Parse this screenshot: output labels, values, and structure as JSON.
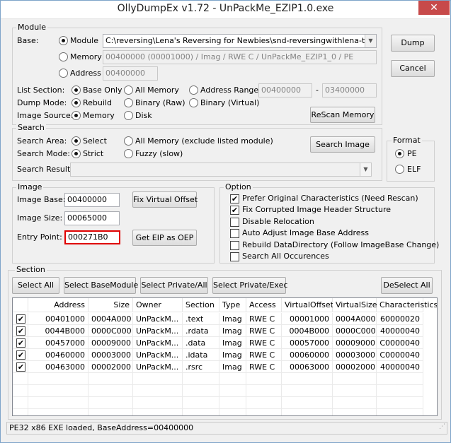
{
  "window": {
    "title": "OllyDumpEx v1.72 - UnPackMe_EZIP1.0.exe",
    "close_glyph": "✕"
  },
  "module": {
    "group_label": "Module",
    "base_label": "Base:",
    "opt_module": "Module",
    "module_path": "C:\\reversing\\Lena's Reversing for Newbies\\snd-reversingwithlena-tutorials\\sn",
    "opt_memory": "Memory",
    "memory_value": "00400000 (00001000) / Imag / RWE C / UnPackMe_EZIP1_0 / PE",
    "opt_address": "Address",
    "address_value": "00400000",
    "list_section_label": "List Section:",
    "ls_base_only": "Base Only",
    "ls_all_memory": "All Memory",
    "ls_address_range": "Address Range",
    "range_from": "00400000",
    "range_dash": "-",
    "range_to": "03400000",
    "dump_mode_label": "Dump Mode:",
    "dm_rebuild": "Rebuild",
    "dm_binary_raw": "Binary (Raw)",
    "dm_binary_virtual": "Binary (Virtual)",
    "image_source_label": "Image Source:",
    "is_memory": "Memory",
    "is_disk": "Disk",
    "rescan_button": "ReScan Memory"
  },
  "search": {
    "group_label": "Search",
    "area_label": "Search Area:",
    "area_select": "Select",
    "area_all_memory": "All Memory (exclude listed module)",
    "mode_label": "Search Mode:",
    "mode_strict": "Strict",
    "mode_fuzzy": "Fuzzy (slow)",
    "result_label": "Search Result:",
    "search_image_button": "Search Image"
  },
  "buttons": {
    "dump": "Dump",
    "cancel": "Cancel"
  },
  "format": {
    "group_label": "Format",
    "pe": "PE",
    "elf": "ELF"
  },
  "image": {
    "group_label": "Image",
    "base_label": "Image Base:",
    "base_value": "00400000",
    "size_label": "Image Size:",
    "size_value": "00065000",
    "entry_label": "Entry Point:",
    "entry_value": "000271B0",
    "fix_offset_button": "Fix Virtual Offset",
    "get_eip_button": "Get EIP as OEP"
  },
  "option": {
    "group_label": "Option",
    "items": [
      {
        "label": "Prefer Original Characteristics (Need Rescan)",
        "checked": "✔"
      },
      {
        "label": "Fix Corrupted Image Header Structure",
        "checked": "✔"
      },
      {
        "label": "Disable Relocation",
        "checked": ""
      },
      {
        "label": "Auto Adjust Image Base Address",
        "checked": ""
      },
      {
        "label": "Rebuild DataDirectory (Follow ImageBase Change)",
        "checked": ""
      },
      {
        "label": "Search All Occurences",
        "checked": ""
      }
    ]
  },
  "section": {
    "group_label": "Section",
    "select_all": "Select All",
    "select_basemodule": "Select BaseModule",
    "select_private_all": "Select Private/All",
    "select_private_exec": "Select Private/Exec",
    "deselect_all": "DeSelect All",
    "columns": [
      "Address",
      "Size",
      "Owner",
      "Section",
      "Type",
      "Access",
      "VirtualOffset",
      "VirtualSize",
      "Characteristics"
    ],
    "rows": [
      {
        "check": "✔",
        "address": "00401000",
        "size": "0004A000",
        "owner": "UnPackM...",
        "section": ".text",
        "type": "Imag",
        "access": "RWE C",
        "voffset": "00001000",
        "vsize": "0004A000",
        "chars": "60000020"
      },
      {
        "check": "✔",
        "address": "0044B000",
        "size": "0000C000",
        "owner": "UnPackM...",
        "section": ".rdata",
        "type": "Imag",
        "access": "RWE C",
        "voffset": "0004B000",
        "vsize": "0000C000",
        "chars": "40000040"
      },
      {
        "check": "✔",
        "address": "00457000",
        "size": "00009000",
        "owner": "UnPackM...",
        "section": ".data",
        "type": "Imag",
        "access": "RWE C",
        "voffset": "00057000",
        "vsize": "00009000",
        "chars": "C0000040"
      },
      {
        "check": "✔",
        "address": "00460000",
        "size": "00003000",
        "owner": "UnPackM...",
        "section": ".idata",
        "type": "Imag",
        "access": "RWE C",
        "voffset": "00060000",
        "vsize": "00003000",
        "chars": "C0000040"
      },
      {
        "check": "✔",
        "address": "00463000",
        "size": "00002000",
        "owner": "UnPackM...",
        "section": ".rsrc",
        "type": "Imag",
        "access": "RWE C",
        "voffset": "00063000",
        "vsize": "00002000",
        "chars": "40000040"
      }
    ]
  },
  "status": {
    "text": "PE32 x86 EXE loaded, BaseAddress=00400000"
  }
}
